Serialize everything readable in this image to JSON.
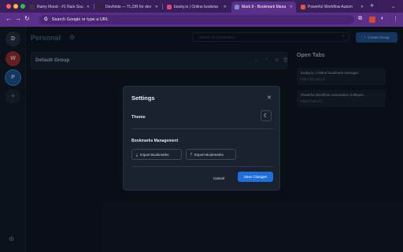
{
  "browser": {
    "tabs": [
      {
        "title": "Rainy Mood - #1 Rain Sou",
        "favicon_color": "#3a3a3a"
      },
      {
        "title": "Devhints — TL;DR for dev",
        "favicon_color": "#2b2b2b"
      },
      {
        "title": "booky.io | Online bookma",
        "favicon_color": "#e0457b"
      },
      {
        "title": "Mark It - Bookmark Mana",
        "favicon_color": "#7b8fc4"
      },
      {
        "title": "Powerful Workflow Autom",
        "favicon_color": "#e25a3a"
      }
    ],
    "new_tab_label": "+",
    "address": "Search Google or type a URL"
  },
  "rail": {
    "avatars": [
      {
        "letter": "D",
        "color": "#2d3440"
      },
      {
        "letter": "W",
        "color": "#b3322c"
      },
      {
        "letter": "P",
        "color": "#1e5fa6"
      }
    ],
    "add_label": "+"
  },
  "workspace": {
    "title": "Personal",
    "search_placeholder": "Search for bookmarks...",
    "create_group_label": "Create Group"
  },
  "groups": [
    {
      "title": "Default Group"
    }
  ],
  "open_tabs": {
    "title": "Open Tabs",
    "items": [
      {
        "title": "booky.io | Online bookmark manager.",
        "url": "https://booky.io/"
      },
      {
        "title": "Powerful Workflow Automation Software ...",
        "url": "https://n8n.io/"
      }
    ]
  },
  "settings_modal": {
    "title": "Settings",
    "theme_label": "Theme",
    "bookmarks_section_label": "Bookmarks Management",
    "import_label": "Import Bookmarks",
    "export_label": "Export Bookmarks",
    "cancel_label": "Cancel",
    "save_label": "Save Changes"
  }
}
